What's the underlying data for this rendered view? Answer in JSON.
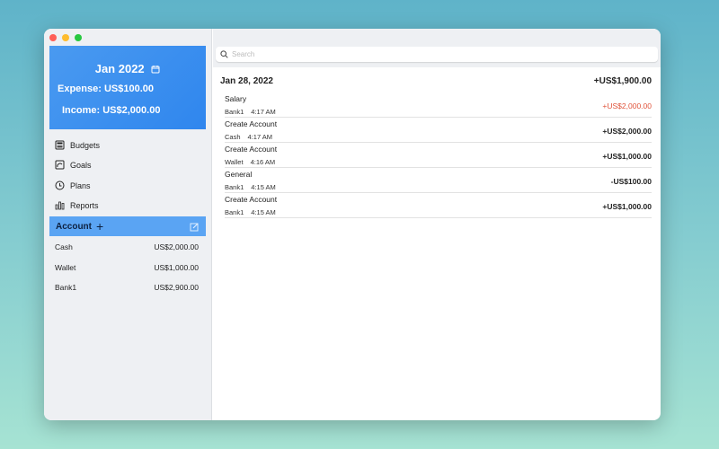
{
  "colors": {
    "accent": "#2f86ee",
    "negative_highlight": "#e0533a"
  },
  "sidebar": {
    "month": "Jan 2022",
    "expense": "Expense: US$100.00",
    "income": "Income: US$2,000.00",
    "nav": [
      {
        "label": "Budgets",
        "icon": "calculator-icon"
      },
      {
        "label": "Goals",
        "icon": "goal-icon"
      },
      {
        "label": "Plans",
        "icon": "clock-icon"
      },
      {
        "label": "Reports",
        "icon": "bar-chart-icon"
      }
    ],
    "account_header": "Account",
    "accounts": [
      {
        "name": "Cash",
        "balance": "US$2,000.00"
      },
      {
        "name": "Wallet",
        "balance": "US$1,000.00"
      },
      {
        "name": "Bank1",
        "balance": "US$2,900.00"
      }
    ]
  },
  "main": {
    "search_placeholder": "Search",
    "date": "Jan 28, 2022",
    "day_total": "+US$1,900.00",
    "transactions": [
      {
        "title": "Salary",
        "account": "Bank1",
        "time": "4:17 AM",
        "amount": "+US$2,000.00",
        "highlight": true
      },
      {
        "title": "Create Account",
        "account": "Cash",
        "time": "4:17 AM",
        "amount": "+US$2,000.00"
      },
      {
        "title": "Create Account",
        "account": "Wallet",
        "time": "4:16 AM",
        "amount": "+US$1,000.00"
      },
      {
        "title": "General",
        "account": "Bank1",
        "time": "4:15 AM",
        "amount": "-US$100.00"
      },
      {
        "title": "Create Account",
        "account": "Bank1",
        "time": "4:15 AM",
        "amount": "+US$1,000.00"
      }
    ]
  }
}
